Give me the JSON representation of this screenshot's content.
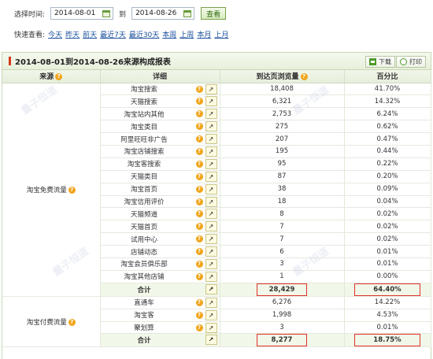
{
  "filter": {
    "select_time_label": "选择时间:",
    "start_date": "2014-08-01",
    "to_label": "到",
    "end_date": "2014-08-26",
    "query_button": "查看"
  },
  "quick": {
    "label": "快速查看:",
    "links": [
      "今天",
      "昨天",
      "前天",
      "最近7天",
      "最近30天",
      "本周",
      "上周",
      "本月",
      "上月"
    ]
  },
  "report": {
    "title": "2014-08-01到2014-08-26来源构成报表",
    "download_label": "下载",
    "print_label": "打印",
    "columns": [
      "来源",
      "详细",
      "到达页浏览量",
      "百分比"
    ],
    "free_group_label": "淘宝免费流量",
    "free_rows": [
      {
        "detail": "淘宝搜索",
        "views": "18,408",
        "percent": "41.70%"
      },
      {
        "detail": "天猫搜索",
        "views": "6,321",
        "percent": "14.32%"
      },
      {
        "detail": "淘宝站内其他",
        "views": "2,753",
        "percent": "6.24%"
      },
      {
        "detail": "淘宝类目",
        "views": "275",
        "percent": "0.62%"
      },
      {
        "detail": "阿里旺旺非广告",
        "views": "207",
        "percent": "0.47%"
      },
      {
        "detail": "淘宝店铺搜索",
        "views": "195",
        "percent": "0.44%"
      },
      {
        "detail": "淘宝客搜索",
        "views": "95",
        "percent": "0.22%"
      },
      {
        "detail": "天猫类目",
        "views": "87",
        "percent": "0.20%"
      },
      {
        "detail": "淘宝首页",
        "views": "38",
        "percent": "0.09%"
      },
      {
        "detail": "淘宝信用评价",
        "views": "18",
        "percent": "0.04%"
      },
      {
        "detail": "天猫频道",
        "views": "8",
        "percent": "0.02%"
      },
      {
        "detail": "天猫首页",
        "views": "7",
        "percent": "0.02%"
      },
      {
        "detail": "试用中心",
        "views": "7",
        "percent": "0.02%"
      },
      {
        "detail": "店铺动态",
        "views": "6",
        "percent": "0.01%"
      },
      {
        "detail": "淘宝会员俱乐部",
        "views": "3",
        "percent": "0.01%"
      },
      {
        "detail": "淘宝其他店铺",
        "views": "1",
        "percent": "0.00%"
      }
    ],
    "free_total": {
      "label": "合计",
      "views": "28,429",
      "percent": "64.40%"
    },
    "paid_group_label": "淘宝付费流量",
    "paid_rows": [
      {
        "detail": "直通车",
        "views": "6,276",
        "percent": "14.22%"
      },
      {
        "detail": "淘宝客",
        "views": "1,998",
        "percent": "4.53%"
      },
      {
        "detail": "聚划算",
        "views": "3",
        "percent": "0.01%"
      }
    ],
    "paid_total": {
      "label": "合计",
      "views": "8,277",
      "percent": "18.75%"
    }
  },
  "icons": {
    "help": "question-icon",
    "trend": "trend-chart-icon",
    "calendar": "calendar-icon"
  },
  "colors": {
    "accent_green": "#4c9a2a",
    "header_bg": "#e7f0dc",
    "highlight_red": "#e0322a",
    "link_blue": "#1a4f9c"
  }
}
